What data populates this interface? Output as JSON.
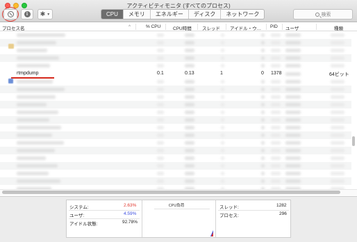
{
  "window": {
    "title": "アクティビティモニタ (すべてのプロセス)"
  },
  "toolbar": {
    "tabs": [
      {
        "label": "CPU",
        "active": true
      },
      {
        "label": "メモリ",
        "active": false
      },
      {
        "label": "エネルギー",
        "active": false
      },
      {
        "label": "ディスク",
        "active": false
      },
      {
        "label": "ネットワーク",
        "active": false
      }
    ],
    "search_placeholder": "検索",
    "icons": [
      "stop-process-icon",
      "info-icon",
      "gear-icon",
      "search-icon"
    ]
  },
  "columns": {
    "process_name": "プロセス名",
    "cpu_percent": "% CPU",
    "cpu_time": "CPU時間",
    "threads": "スレッド",
    "idle_wake": "アイドル・ウ…",
    "pid": "PID",
    "user": "ユーザ",
    "kind": "種類"
  },
  "selected_process": {
    "name": "rtmpdump",
    "cpu_percent": "0.1",
    "cpu_time": "0.13",
    "threads": "1",
    "idle_wake": "0",
    "pid": "1378",
    "kind": "64ビット"
  },
  "stats": {
    "system_label": "システム:",
    "system_value": "2.63%",
    "user_label": "ユーザ:",
    "user_value": "4.59%",
    "idle_label": "アイドル状態:",
    "idle_value": "92.78%",
    "graph_title": "CPU負荷",
    "threads_label": "スレッド:",
    "threads_value": "1282",
    "processes_label": "プロセス:",
    "processes_value": "296",
    "system_color": "#e0372e",
    "user_color": "#3d4fe0"
  }
}
